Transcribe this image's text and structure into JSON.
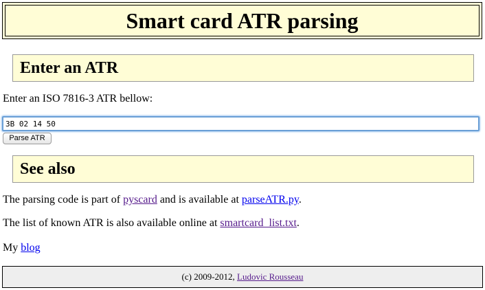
{
  "page": {
    "title": "Smart card ATR parsing"
  },
  "enter_section": {
    "heading": "Enter an ATR",
    "instruction": "Enter an ISO 7816-3 ATR bellow:",
    "atr_value": "3B 02 14 50",
    "button_label": "Parse ATR"
  },
  "see_also": {
    "heading": "See also",
    "line1_prefix": "The parsing code is part of ",
    "line1_link1": "pyscard",
    "line1_middle": " and is available at ",
    "line1_link2": "parseATR.py",
    "line1_suffix": ".",
    "line2_prefix": "The list of known ATR is also available online at ",
    "line2_link": "smartcard_list.txt",
    "line2_suffix": ".",
    "line3_prefix": "My ",
    "line3_link": "blog"
  },
  "footer": {
    "copyright": "(c) 2009-2012, ",
    "author_link": "Ludovic Rousseau"
  },
  "colors": {
    "heading_background": "#fffdd6",
    "footer_background": "#eeeeee",
    "link": "#0000ee",
    "visited_link": "#551a8b",
    "input_focus": "#6a9fd6"
  }
}
